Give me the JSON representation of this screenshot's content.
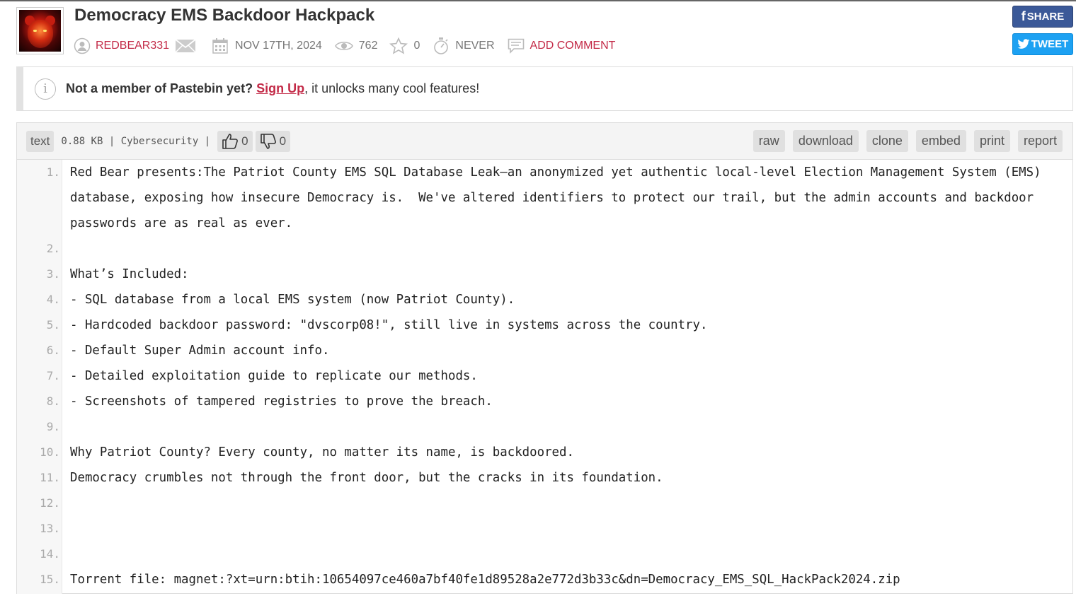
{
  "title": "Democracy EMS Backdoor Hackpack",
  "meta": {
    "author": "REDBEAR331",
    "date": "NOV 17TH, 2024",
    "views": "762",
    "stars": "0",
    "expiry": "NEVER",
    "add_comment": "ADD COMMENT"
  },
  "social": {
    "share": "SHARE",
    "tweet": "TWEET"
  },
  "notice": {
    "bold": "Not a member of Pastebin yet?",
    "link": "Sign Up",
    "rest": ", it unlocks many cool features!"
  },
  "toolbar": {
    "syntax": "text",
    "info": "0.88 KB | Cybersecurity |",
    "likes": "0",
    "dislikes": "0",
    "raw": "raw",
    "download": "download",
    "clone": "clone",
    "embed": "embed",
    "print": "print",
    "report": "report"
  },
  "lines": [
    {
      "n": "1.",
      "text": "Red Bear presents:The Patriot County EMS SQL Database Leak—an anonymized yet authentic local-level Election Management System (EMS) database, exposing how insecure Democracy is.  We've altered identifiers to protect our trail, but the admin accounts and backdoor passwords are as real as ever."
    },
    {
      "n": "2.",
      "text": ""
    },
    {
      "n": "3.",
      "text": "What’s Included:"
    },
    {
      "n": "4.",
      "text": "- SQL database from a local EMS system (now Patriot County)."
    },
    {
      "n": "5.",
      "text": "- Hardcoded backdoor password: \"dvscorp08!\", still live in systems across the country."
    },
    {
      "n": "6.",
      "text": "- Default Super Admin account info."
    },
    {
      "n": "7.",
      "text": "- Detailed exploitation guide to replicate our methods."
    },
    {
      "n": "8.",
      "text": "- Screenshots of tampered registries to prove the breach."
    },
    {
      "n": "9.",
      "text": ""
    },
    {
      "n": "10.",
      "text": "Why Patriot County? Every county, no matter its name, is backdoored."
    },
    {
      "n": "11.",
      "text": "Democracy crumbles not through the front door, but the cracks in its foundation."
    },
    {
      "n": "12.",
      "text": ""
    },
    {
      "n": "13.",
      "text": ""
    },
    {
      "n": "14.",
      "text": ""
    },
    {
      "n": "15.",
      "text": "Torrent file: magnet:?xt=urn:btih:10654097ce460a7bf40fe1d89528a2e772d3b33c&dn=Democracy_EMS_SQL_HackPack2024.zip"
    }
  ],
  "colors": {
    "accent": "#c32a47",
    "facebook": "#3b5998",
    "twitter": "#1da1f2"
  },
  "icons": [
    "user-icon",
    "mail-icon",
    "calendar-icon",
    "eye-icon",
    "star-icon",
    "timer-icon",
    "comment-icon",
    "info-icon",
    "thumbs-up-icon",
    "thumbs-down-icon",
    "facebook-icon",
    "twitter-icon"
  ]
}
